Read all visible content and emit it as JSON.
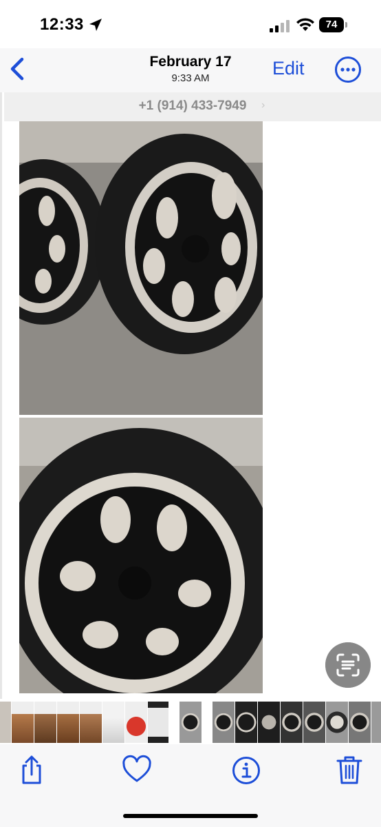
{
  "status_bar": {
    "time": "12:33",
    "battery": "74"
  },
  "nav": {
    "title": "February 17",
    "subtitle": "9:33 AM",
    "edit_label": "Edit"
  },
  "photo": {
    "phone_number": "+1 (914) 433-7949"
  },
  "icons": {
    "back": "chevron-left-icon",
    "more": "ellipsis-circle-icon",
    "live_text": "live-text-scan-icon",
    "share": "share-icon",
    "favorite": "heart-icon",
    "info": "info-icon",
    "delete": "trash-icon"
  },
  "colors": {
    "accent": "#1d4ed8",
    "toolbar_bg": "#f7f7f8"
  }
}
